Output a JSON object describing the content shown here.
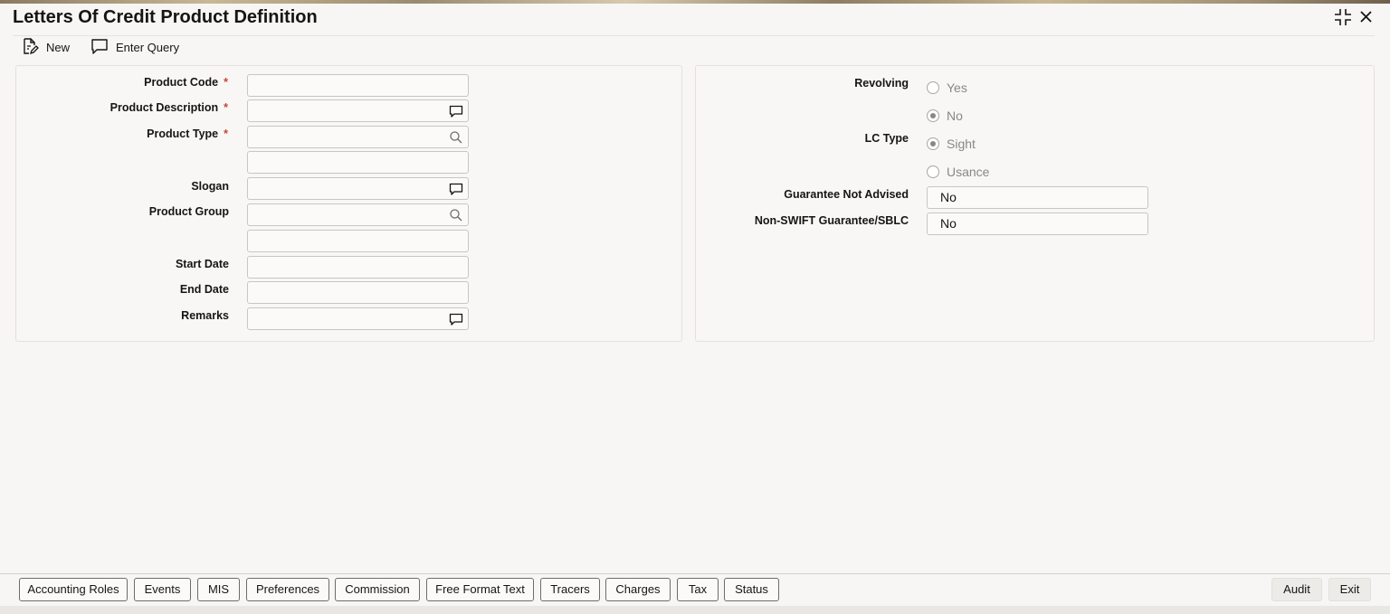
{
  "window": {
    "title": "Letters Of Credit Product Definition"
  },
  "toolbar": {
    "new_label": "New",
    "enter_query_label": "Enter Query"
  },
  "left_panel": {
    "product_code_label": "Product Code",
    "product_description_label": "Product Description",
    "product_type_label": "Product Type",
    "slogan_label": "Slogan",
    "product_group_label": "Product Group",
    "start_date_label": "Start Date",
    "end_date_label": "End Date",
    "remarks_label": "Remarks",
    "required_mark": "*"
  },
  "right_panel": {
    "revolving_label": "Revolving",
    "revolving_options": [
      "Yes",
      "No"
    ],
    "revolving_selected": "No",
    "lc_type_label": "LC Type",
    "lc_type_options": [
      "Sight",
      "Usance"
    ],
    "lc_type_selected": "Sight",
    "guarantee_not_advised_label": "Guarantee Not Advised",
    "guarantee_not_advised_value": "No",
    "non_swift_label": "Non-SWIFT Guarantee/SBLC",
    "non_swift_value": "No"
  },
  "footer": {
    "buttons": [
      "Accounting Roles",
      "Events",
      "MIS",
      "Preferences",
      "Commission",
      "Free Format Text",
      "Tracers",
      "Charges",
      "Tax",
      "Status"
    ],
    "audit_label": "Audit",
    "exit_label": "Exit"
  }
}
